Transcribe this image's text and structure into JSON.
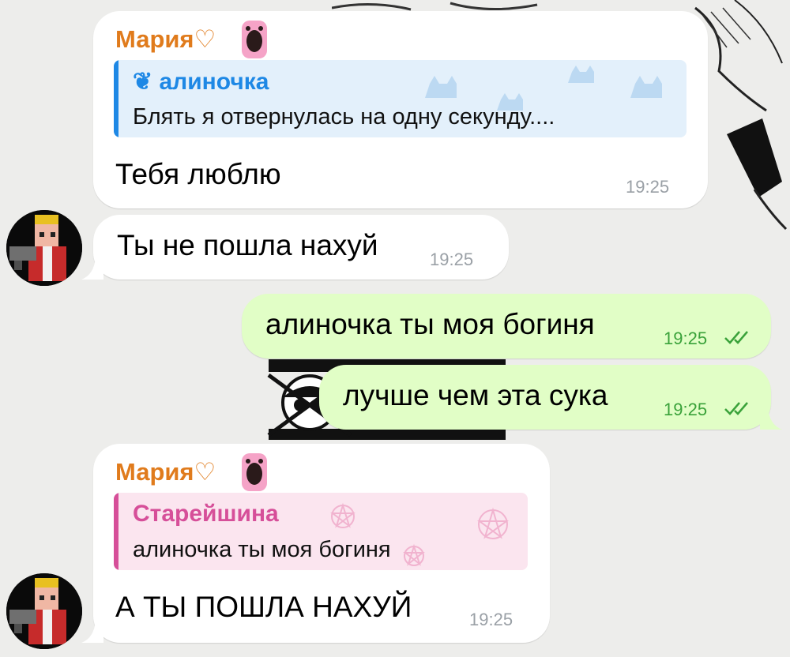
{
  "colors": {
    "background": "#ededeb",
    "incoming_bubble": "#ffffff",
    "outgoing_bubble": "#e1fec6",
    "sender_name": "#e07b1c",
    "reply_blue": "#1e88e5",
    "reply_pink": "#d64f99",
    "time_in": "#9aa0a6",
    "time_out": "#3aa23a"
  },
  "messages": [
    {
      "sender": "Мария",
      "sender_heart": "♡",
      "reply_to": {
        "name": "алиночка",
        "icon": "heart-bow-icon",
        "text": "Блять я отвернулась на одну секунду...."
      },
      "text": "Тебя люблю",
      "time": "19:25"
    },
    {
      "text": "Ты не пошла нахуй",
      "time": "19:25",
      "avatar": "pixel-king-avatar"
    },
    {
      "text": "алиночка ты моя богиня",
      "time": "19:25",
      "status": "read-double-check-icon"
    },
    {
      "text": "лучше чем эта сука",
      "time": "19:25",
      "status": "read-double-check-icon"
    },
    {
      "sender": "Мария",
      "sender_heart": "♡",
      "reply_to": {
        "name": "Старейшина",
        "text": "алиночка ты моя богиня"
      },
      "text": "А ТЫ ПОШЛА НАХУЙ",
      "time": "19:25",
      "avatar": "pixel-king-avatar"
    }
  ]
}
